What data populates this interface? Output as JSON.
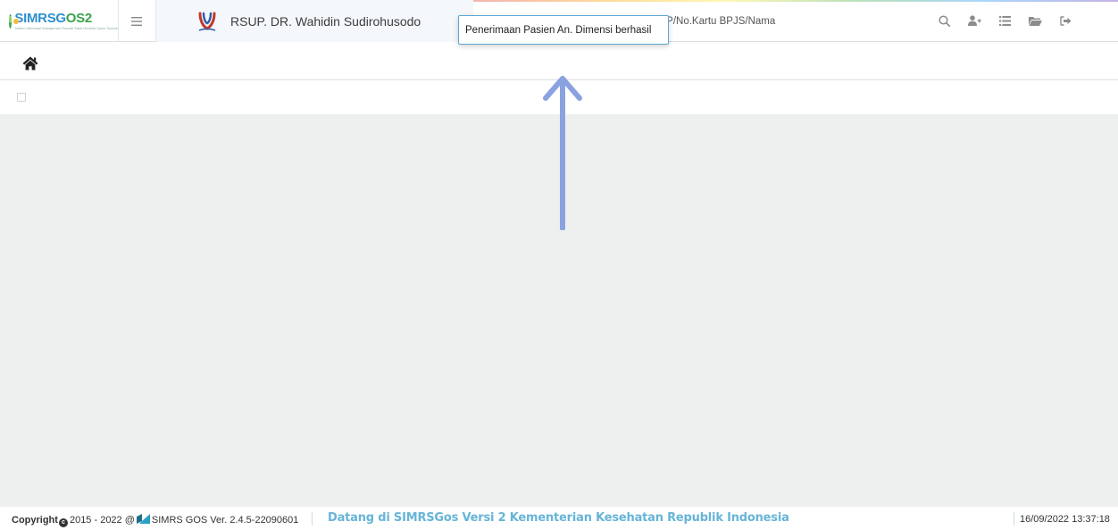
{
  "brand": {
    "name_part1": "SIMRSG",
    "name_part2": "OS2",
    "tagline": "Sistem Informasi Manajemen Rumah Sakit Generik Open Source"
  },
  "header": {
    "hospital_name": "RSUP. DR. Wahidin Sudirohusodo",
    "search_placeholder": "Cari Pasien dgn Memasukkan No.RM/No.KTP/No.Kartu BPJS/Nama",
    "notification": "Penerimaan Pasien An. Dimensi berhasil",
    "icons": [
      "search-icon",
      "add-user-icon",
      "list-icon",
      "folder-icon",
      "logout-icon"
    ]
  },
  "footer": {
    "copyright_prefix": "Copyright",
    "copyright_years": "2015 - 2022 @",
    "version": "SIMRS GOS Ver. 2.4.5-22090601",
    "marquee": "Datang di SIMRSGos Versi 2 Kementerian Kesehatan Republik Indonesia",
    "datetime": "16/09/2022 13:37:18"
  },
  "colors": {
    "accent_blue": "#2e8fcf",
    "brand_green": "#3aa54a",
    "content_bg": "#edf0ef",
    "marquee_text": "#66b4d8",
    "arrow": "#8aa3e0"
  }
}
